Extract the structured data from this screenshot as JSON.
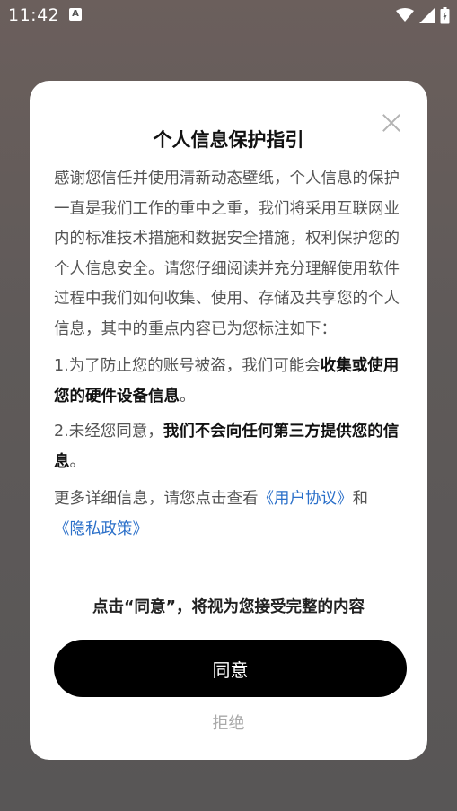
{
  "status_bar": {
    "time": "11:42",
    "notification_icon": "A",
    "icons": [
      "wifi-icon",
      "signal-icon",
      "battery-icon"
    ]
  },
  "dialog": {
    "title": "个人信息保护指引",
    "paragraph1": "感谢您信任并使用清新动态壁纸，个人信息的保护一直是我们工作的重中之重，我们将采用互联网业内的标准技术措施和数据安全措施，权利保护您的个人信息安全。请您仔细阅读并充分理解使用软件过程中我们如何收集、使用、存储及共享您的个人信息，其中的重点内容已为您标注如下：",
    "item1_prefix": "1.为了防止您的账号被盗，我们可能会",
    "item1_bold": "收集或使用您的硬件设备信息",
    "item1_suffix": "。",
    "item2_prefix": "2.未经您同意，",
    "item2_bold": "我们不会向任何第三方提供您的信息",
    "item2_suffix": "。",
    "more_prefix": "更多详细信息，请您点击查看",
    "user_agreement_link": "《用户协议》",
    "more_and": "和",
    "privacy_policy_link": "《隐私政策》",
    "notice": "点击“同意”，将视为您接受完整的内容",
    "agree_label": "同意",
    "refuse_label": "拒绝"
  },
  "colors": {
    "link": "#2a6fc9",
    "primary_button": "#000000"
  }
}
